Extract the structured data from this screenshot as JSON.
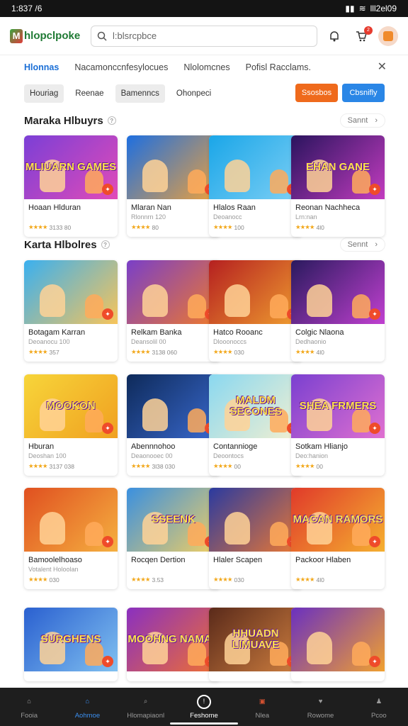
{
  "status": {
    "time": "1:837 /6",
    "battery_label": "lll2el09"
  },
  "app": {
    "logo_text": "hlopclpoke",
    "search_placeholder": "l:blsrcpbce",
    "notif_count": "2"
  },
  "categories": [
    "Hlonnas",
    "Nacamonccnfesylocues",
    "Nlolomcnes",
    "Pofisl Racclams."
  ],
  "filters": {
    "chips": [
      "Houriag",
      "Reenae",
      "Bamenncs",
      "Ohonpeci"
    ],
    "orange_btn": "Ssosbos",
    "blue_btn": "Cbsnifly"
  },
  "sections": [
    {
      "title": "Maraka Hlbuyrs",
      "see_all": "Sannt"
    },
    {
      "title": "Karta Hlbolres",
      "see_all": "Sennt"
    }
  ],
  "cards_row1": [
    {
      "name": "Hoaan Hlduran",
      "sub": "",
      "meta": "3133 80",
      "art": "MLIUARN GAMES",
      "colors": [
        "#7b3fd6",
        "#e14bb8"
      ]
    },
    {
      "name": "Mlaran Nan",
      "sub": "Rlonnrn 120",
      "meta": "80",
      "art": "",
      "colors": [
        "#1e6fe0",
        "#f0a23a"
      ]
    },
    {
      "name": "Hlalos Raan",
      "sub": "Deoanocc",
      "meta": "100",
      "art": "",
      "colors": [
        "#1aa6e8",
        "#7fd0f5"
      ]
    },
    {
      "name": "Reonan Nachheca",
      "sub": "Lrn:nan",
      "meta": "4l0",
      "art": "EHAN GANE",
      "colors": [
        "#2a145e",
        "#c23cbf"
      ]
    }
  ],
  "cards_row2": [
    {
      "name": "Botagam Karran",
      "sub": "Deoanocu 100",
      "meta": "357",
      "art": "",
      "colors": [
        "#3ab0f0",
        "#f7c45a"
      ]
    },
    {
      "name": "Relkam Banka",
      "sub": "Deansolil 00",
      "meta": "3138 060",
      "art": "",
      "colors": [
        "#7a3fc8",
        "#f07a2a"
      ]
    },
    {
      "name": "Hatco Rooanc",
      "sub": "Dlooonoccs",
      "meta": "030",
      "art": "",
      "colors": [
        "#b52020",
        "#f0a030"
      ]
    },
    {
      "name": "Colgic Nlaona",
      "sub": "Dedhaonio",
      "meta": "4l0",
      "art": "",
      "colors": [
        "#2a1a5e",
        "#c040d0"
      ]
    }
  ],
  "cards_row3": [
    {
      "name": "Hburan",
      "sub": "Deoshan 100",
      "meta": "3137 038",
      "art": "MOOKON",
      "colors": [
        "#f7d53a",
        "#f0a020"
      ]
    },
    {
      "name": "Abennnohoo",
      "sub": "Deaonooec 00",
      "meta": "3l38 030",
      "art": "",
      "colors": [
        "#0e2a5a",
        "#3a6ad0"
      ]
    },
    {
      "name": "Contannioge",
      "sub": "Deoontocs",
      "meta": "00",
      "art": "MALDM SECONES",
      "colors": [
        "#8ad8f0",
        "#f5f0d0"
      ]
    },
    {
      "name": "Sotkam Hlianjo",
      "sub": "Deo:hanion",
      "meta": "00",
      "art": "SHEA FRMERS",
      "colors": [
        "#7a40d0",
        "#e070d0"
      ]
    }
  ],
  "cards_row4": [
    {
      "name": "Bamoolelhoaso",
      "sub": "Votalent Holoolan",
      "meta": "030",
      "art": "",
      "colors": [
        "#e05020",
        "#f5b040"
      ]
    },
    {
      "name": "Rocqen Dertion",
      "sub": "",
      "meta": "3.53",
      "art": "SSEENK",
      "colors": [
        "#3a90e0",
        "#f5d060"
      ]
    },
    {
      "name": "Hlaler Scapen",
      "sub": "",
      "meta": "030",
      "art": "",
      "colors": [
        "#2a3aa0",
        "#f07a30"
      ]
    },
    {
      "name": "Packoor Hlaben",
      "sub": "",
      "meta": "4l0",
      "art": "MACAN RAMORS",
      "colors": [
        "#e03a2a",
        "#f5b030"
      ]
    }
  ],
  "cards_row5": [
    {
      "name": "",
      "sub": "",
      "meta": "",
      "art": "SURGHENS",
      "colors": [
        "#2a60d0",
        "#80c0f0"
      ]
    },
    {
      "name": "",
      "sub": "",
      "meta": "",
      "art": "MOOHNG NAMAN",
      "colors": [
        "#8a30c0",
        "#f07030"
      ]
    },
    {
      "name": "",
      "sub": "",
      "meta": "",
      "art": "HHUADN LIMUAVE",
      "colors": [
        "#5a2a1a",
        "#d08040"
      ]
    },
    {
      "name": "",
      "sub": "",
      "meta": "",
      "art": "",
      "colors": [
        "#6a30c0",
        "#f0a030"
      ]
    }
  ],
  "nav": [
    {
      "label": "Fooia",
      "icon": "home-icon"
    },
    {
      "label": "Aohmoe",
      "icon": "home-filled-icon"
    },
    {
      "label": "Hlomapiaonl",
      "icon": "search-icon"
    },
    {
      "label": "Feshome",
      "icon": "clock-icon"
    },
    {
      "label": "Nlea",
      "icon": "square-icon"
    },
    {
      "label": "Rowome",
      "icon": "heart-icon"
    },
    {
      "label": "Pcoo",
      "icon": "person-icon"
    }
  ]
}
